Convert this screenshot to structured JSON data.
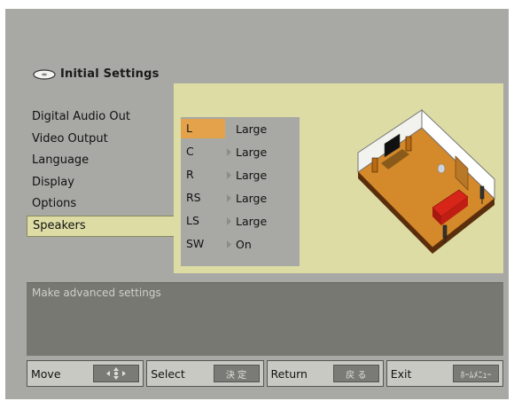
{
  "header": {
    "title": "Initial Settings",
    "icon": "disc-icon"
  },
  "menu": {
    "items": [
      {
        "label": "Digital Audio Out"
      },
      {
        "label": "Video Output"
      },
      {
        "label": "Language"
      },
      {
        "label": "Display"
      },
      {
        "label": "Options"
      },
      {
        "label": "Speakers"
      }
    ],
    "selected": "Speakers"
  },
  "speakers": [
    {
      "channel": "L",
      "value": "Large"
    },
    {
      "channel": "C",
      "value": "Large"
    },
    {
      "channel": "R",
      "value": "Large"
    },
    {
      "channel": "RS",
      "value": "Large"
    },
    {
      "channel": "LS",
      "value": "Large"
    },
    {
      "channel": "SW",
      "value": "On"
    }
  ],
  "description": "Make advanced settings",
  "bottom": [
    {
      "label": "Move",
      "key": "arrows-icon"
    },
    {
      "label": "Select",
      "key": "決 定"
    },
    {
      "label": "Return",
      "key": "戻 る"
    },
    {
      "label": "Exit",
      "key": "ﾎｰﾑﾒﾆｭｰ"
    }
  ],
  "colors": {
    "screen_bg": "#a8a9a4",
    "highlight_panel": "#dcdca4",
    "active_item": "#e4a24a",
    "desc_bg": "#787873"
  }
}
